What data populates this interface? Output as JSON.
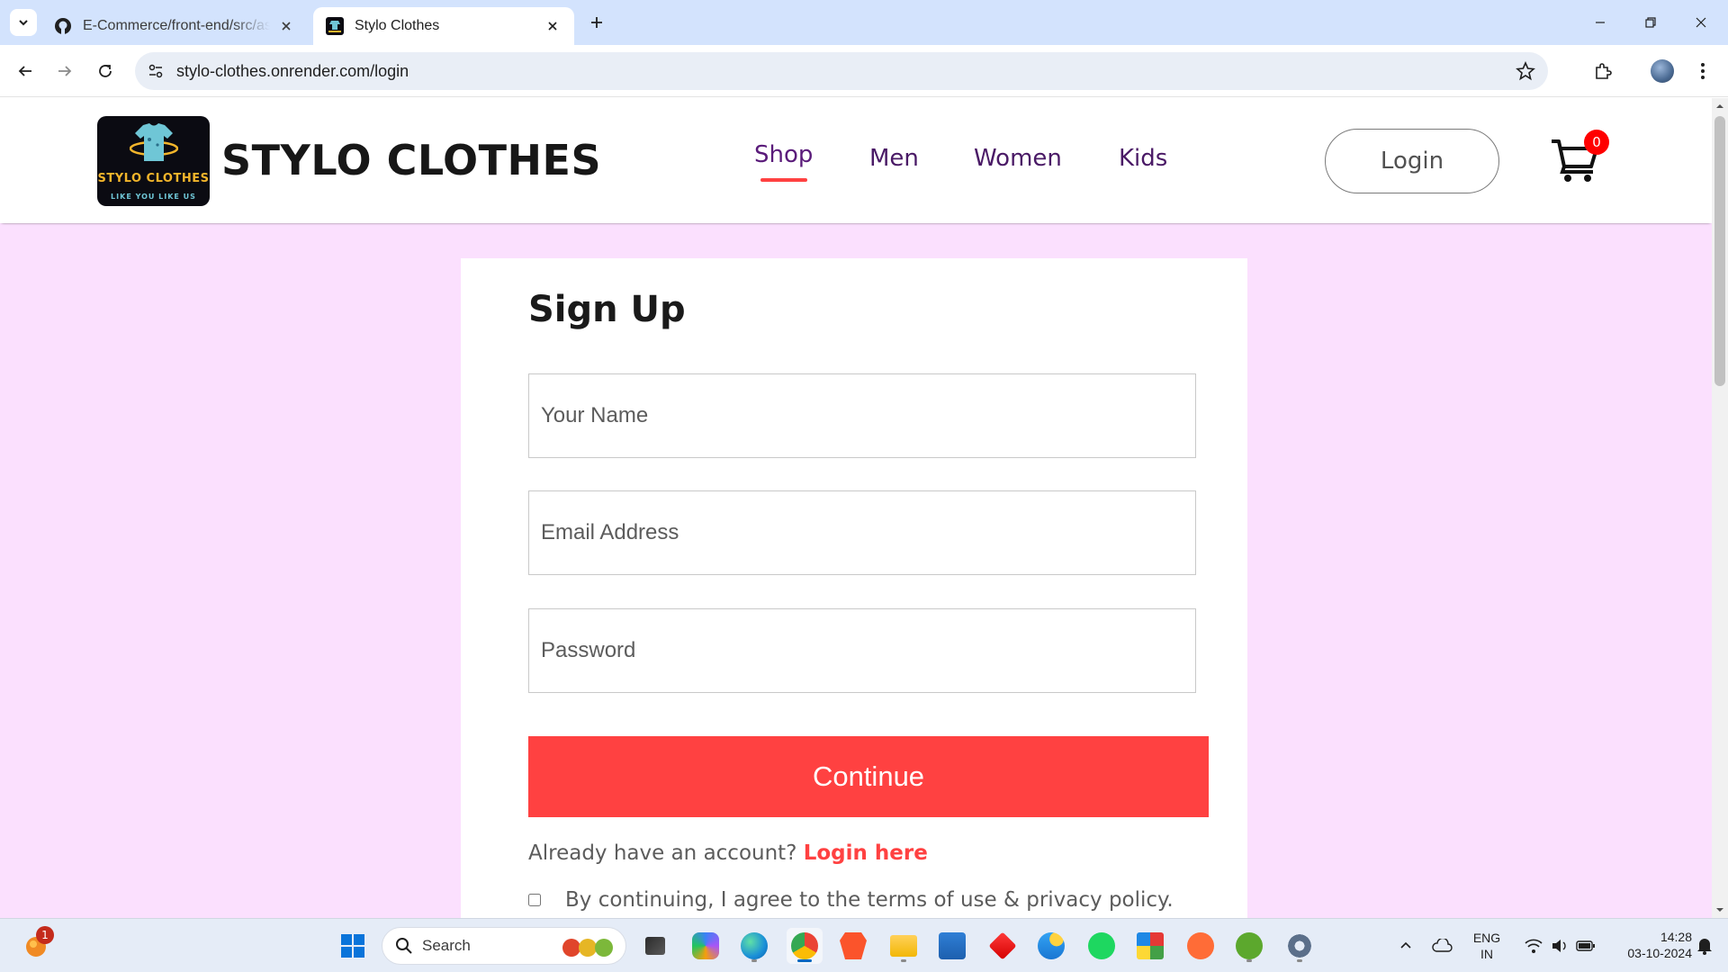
{
  "browser": {
    "tabs": [
      {
        "title": "E-Commerce/front-end/src/assets",
        "icon": "github-icon"
      },
      {
        "title": "Stylo Clothes",
        "icon": "stylo-favicon"
      }
    ],
    "url": "stylo-clothes.onrender.com/login"
  },
  "site": {
    "logo_line1": "STYLO CLOTHES",
    "logo_line2": "LIKE YOU LIKE US",
    "brand": "STYLO CLOTHES",
    "menu": {
      "shop": "Shop",
      "men": "Men",
      "women": "Women",
      "kids": "Kids"
    },
    "login_label": "Login",
    "cart_count": "0"
  },
  "signup": {
    "title": "Sign Up",
    "name_placeholder": "Your Name",
    "email_placeholder": "Email Address",
    "password_placeholder": "Password",
    "continue_label": "Continue",
    "already_text": "Already have an account?",
    "login_link": "Login here",
    "agree_text": "By continuing, I agree to the terms of use & privacy policy."
  },
  "taskbar": {
    "search_label": "Search",
    "notification_badge": "1",
    "lang": "ENG",
    "region": "IN",
    "time": "14:28",
    "date": "03-10-2024"
  },
  "colors": {
    "accent": "#ff4141",
    "page_bg": "#fbe0fe",
    "menu_text": "#4a1a66",
    "cart_badge": "#ff0000"
  }
}
